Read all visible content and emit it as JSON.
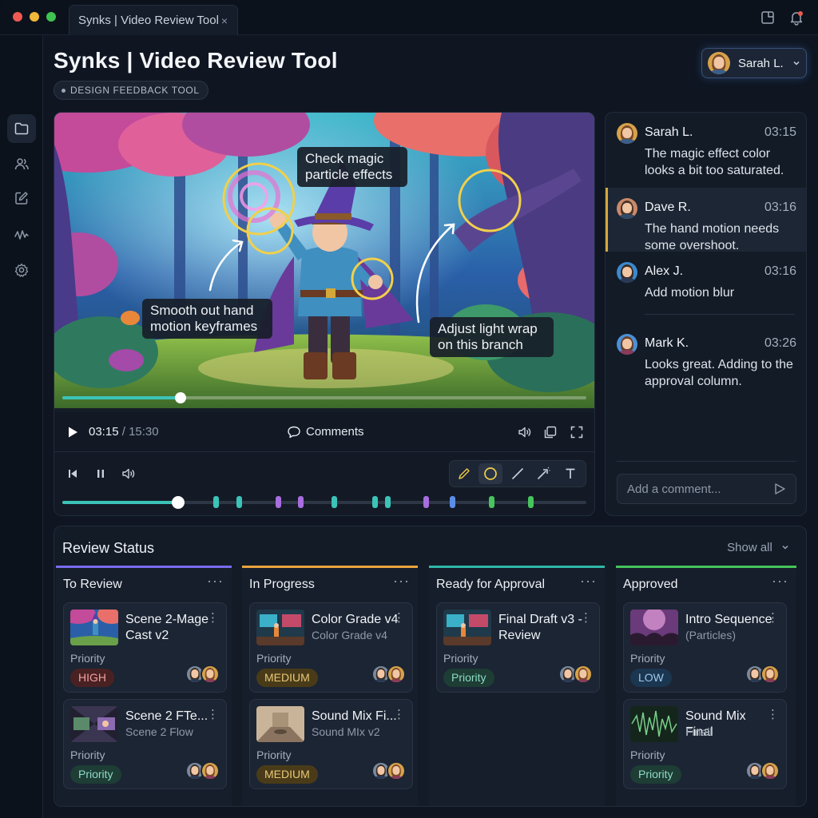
{
  "window": {
    "tab_title": "Synks | Video Review Tool",
    "tab_close": "×"
  },
  "header": {
    "title": "Synks | Video Review Tool",
    "badge": "DESIGN FEEDBACK TOOL",
    "user_name": "Sarah L."
  },
  "player": {
    "annotations": {
      "magic": "Check magic particle effects",
      "hand": "Smooth out hand motion keyframes",
      "branch": "Adjust light wrap on this branch"
    },
    "progress": 0.226,
    "current_time": "03:15",
    "separator": " / ",
    "total_time": "15:30",
    "comments_label": "Comments",
    "timeline_progress": 0.221,
    "markers": [
      {
        "pos": 0.293,
        "color": "#3cc3b8"
      },
      {
        "pos": 0.337,
        "color": "#3cc3b8"
      },
      {
        "pos": 0.411,
        "color": "#a86ee0"
      },
      {
        "pos": 0.455,
        "color": "#a86ee0"
      },
      {
        "pos": 0.519,
        "color": "#3cc3b8"
      },
      {
        "pos": 0.596,
        "color": "#3cc3b8"
      },
      {
        "pos": 0.621,
        "color": "#3cc3b8"
      },
      {
        "pos": 0.693,
        "color": "#a86ee0"
      },
      {
        "pos": 0.744,
        "color": "#5b8de8"
      },
      {
        "pos": 0.818,
        "color": "#47c45d"
      },
      {
        "pos": 0.894,
        "color": "#47c45d"
      }
    ]
  },
  "comments": {
    "items": [
      {
        "author": "Sarah L.",
        "time": "03:15",
        "text": "The magic effect color looks a bit too saturated.",
        "selected": false
      },
      {
        "author": "Dave R.",
        "time": "03:16",
        "text": "The hand motion needs some overshoot.",
        "selected": true
      },
      {
        "author": "Alex J.",
        "time": "03:16",
        "text": "Add motion blur",
        "selected": false
      },
      {
        "author": "Mark K.",
        "time": "03:26",
        "text": "Looks great. Adding to the approval column.",
        "selected": false
      }
    ],
    "input_placeholder": "Add a comment..."
  },
  "review": {
    "title": "Review Status",
    "show_all": "Show all",
    "more": "···",
    "card_more": "⋮",
    "priority_label": "Priority",
    "columns": [
      {
        "title": "To Review",
        "accent": "#7a6cf0",
        "cards": [
          {
            "title": "Scene 2-Mage\nCast v2",
            "subtitle": "",
            "badge": "HIGH",
            "badge_kind": "high",
            "thumb": "mage"
          },
          {
            "title": "Scene 2 FTe...",
            "subtitle": "Scene 2 Flow",
            "badge": "Priority",
            "badge_kind": "normal",
            "thumb": "flow"
          }
        ]
      },
      {
        "title": "In Progress",
        "accent": "#e8a33d",
        "cards": [
          {
            "title": "Color Grade v4",
            "subtitle": "Color Grade v4",
            "badge": "MEDIUM",
            "badge_kind": "medium",
            "thumb": "grade"
          },
          {
            "title": "Sound Mix Fi...",
            "subtitle": "Sound MIx v2",
            "badge": "MEDIUM",
            "badge_kind": "medium",
            "thumb": "room"
          }
        ]
      },
      {
        "title": "Ready for Approval",
        "accent": "#2fb8a8",
        "cards": [
          {
            "title": "Final Draft v3 -\nReview",
            "subtitle": "",
            "badge": "Priority",
            "badge_kind": "normal",
            "thumb": "grade"
          }
        ]
      },
      {
        "title": "Approved",
        "accent": "#45c45a",
        "cards": [
          {
            "title": "Intro Sequence",
            "subtitle": "(Particles)",
            "badge": "LOW",
            "badge_kind": "low",
            "thumb": "concert"
          },
          {
            "title": "Sound Mix Final",
            "subtitle": "Finall",
            "badge": "Priority",
            "badge_kind": "normal",
            "thumb": "wave"
          }
        ]
      }
    ]
  }
}
